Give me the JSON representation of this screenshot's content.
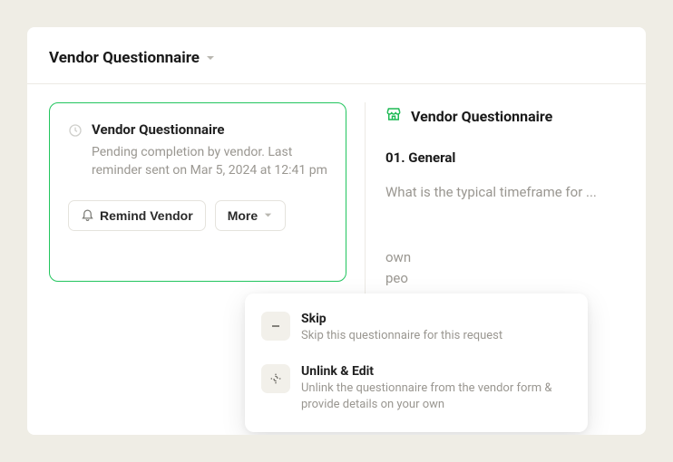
{
  "header": {
    "title": "Vendor Questionnaire"
  },
  "leftCard": {
    "title": "Vendor Questionnaire",
    "description": "Pending completion by vendor. Last reminder sent on Mar 5, 2024 at 12:41 pm",
    "remindLabel": "Remind Vendor",
    "moreLabel": "More"
  },
  "rightPanel": {
    "title": "Vendor Questionnaire",
    "sectionLabel": "01. General",
    "question": "What is the typical timeframe for ...",
    "hintLine1": "own",
    "hintLine2": "peo"
  },
  "menu": {
    "items": [
      {
        "title": "Skip",
        "desc": "Skip this questionnaire for this request"
      },
      {
        "title": "Unlink & Edit",
        "desc": "Unlink the questionnaire from the vendor form & provide details on your own"
      }
    ]
  }
}
